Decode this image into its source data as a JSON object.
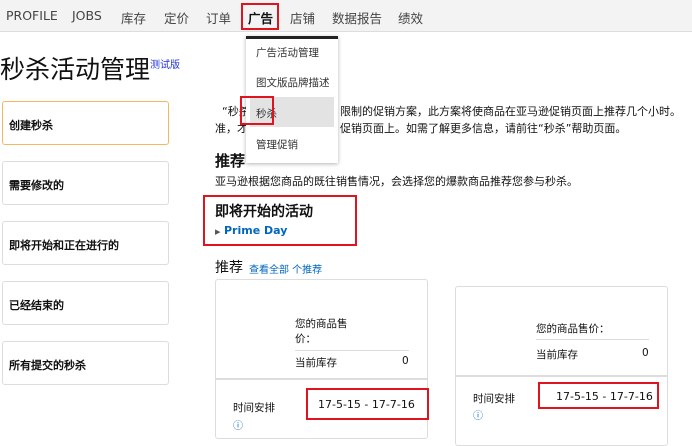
{
  "nav": {
    "items": [
      "PROFILE",
      "JOBS",
      "库存",
      "定价",
      "订单",
      "广告",
      "店铺",
      "数据报告",
      "绩效"
    ],
    "active": "广告"
  },
  "dropdown": {
    "items": [
      "广告活动管理",
      "图文版品牌描述",
      "秒杀",
      "管理促销"
    ],
    "selected": "秒杀"
  },
  "page": {
    "title": "秒杀活动管理",
    "badge": "测试版"
  },
  "sidebar": {
    "items": [
      "创建秒杀",
      "需要修改的",
      "即将开始和正在进行的",
      "已经结束的",
      "所有提交的秒杀"
    ]
  },
  "intro": {
    "line1_start": "“秒杀",
    "line1_end": "限制的促销方案，此方案将使商品在亚马逊促销页面上推荐几个小时。",
    "line2_start": "准，才",
    "line2_end": "促销页面上。如需了解更多信息，请前往“秒杀”帮助页面。"
  },
  "recommend": {
    "heading": "推荐",
    "text": "亚马逊根据您商品的既往销售情况，会选择您的爆款商品推荐您参与秒杀。"
  },
  "upcoming": {
    "heading": "即将开始的活动",
    "link": "Prime Day"
  },
  "recs": {
    "heading": "推荐",
    "view_all": "查看全部 个推荐"
  },
  "cards": [
    {
      "price_label": "您的商品售价：",
      "stock_label": "当前库存",
      "stock": "0",
      "schedule_label": "时间安排",
      "schedule": "17-5-15 - 17-7-16"
    },
    {
      "price_label": "您的商品售价：",
      "stock_label": "当前库存",
      "stock": "0",
      "schedule_label": "时间安排",
      "schedule": "17-5-15 - 17-7-16"
    }
  ]
}
